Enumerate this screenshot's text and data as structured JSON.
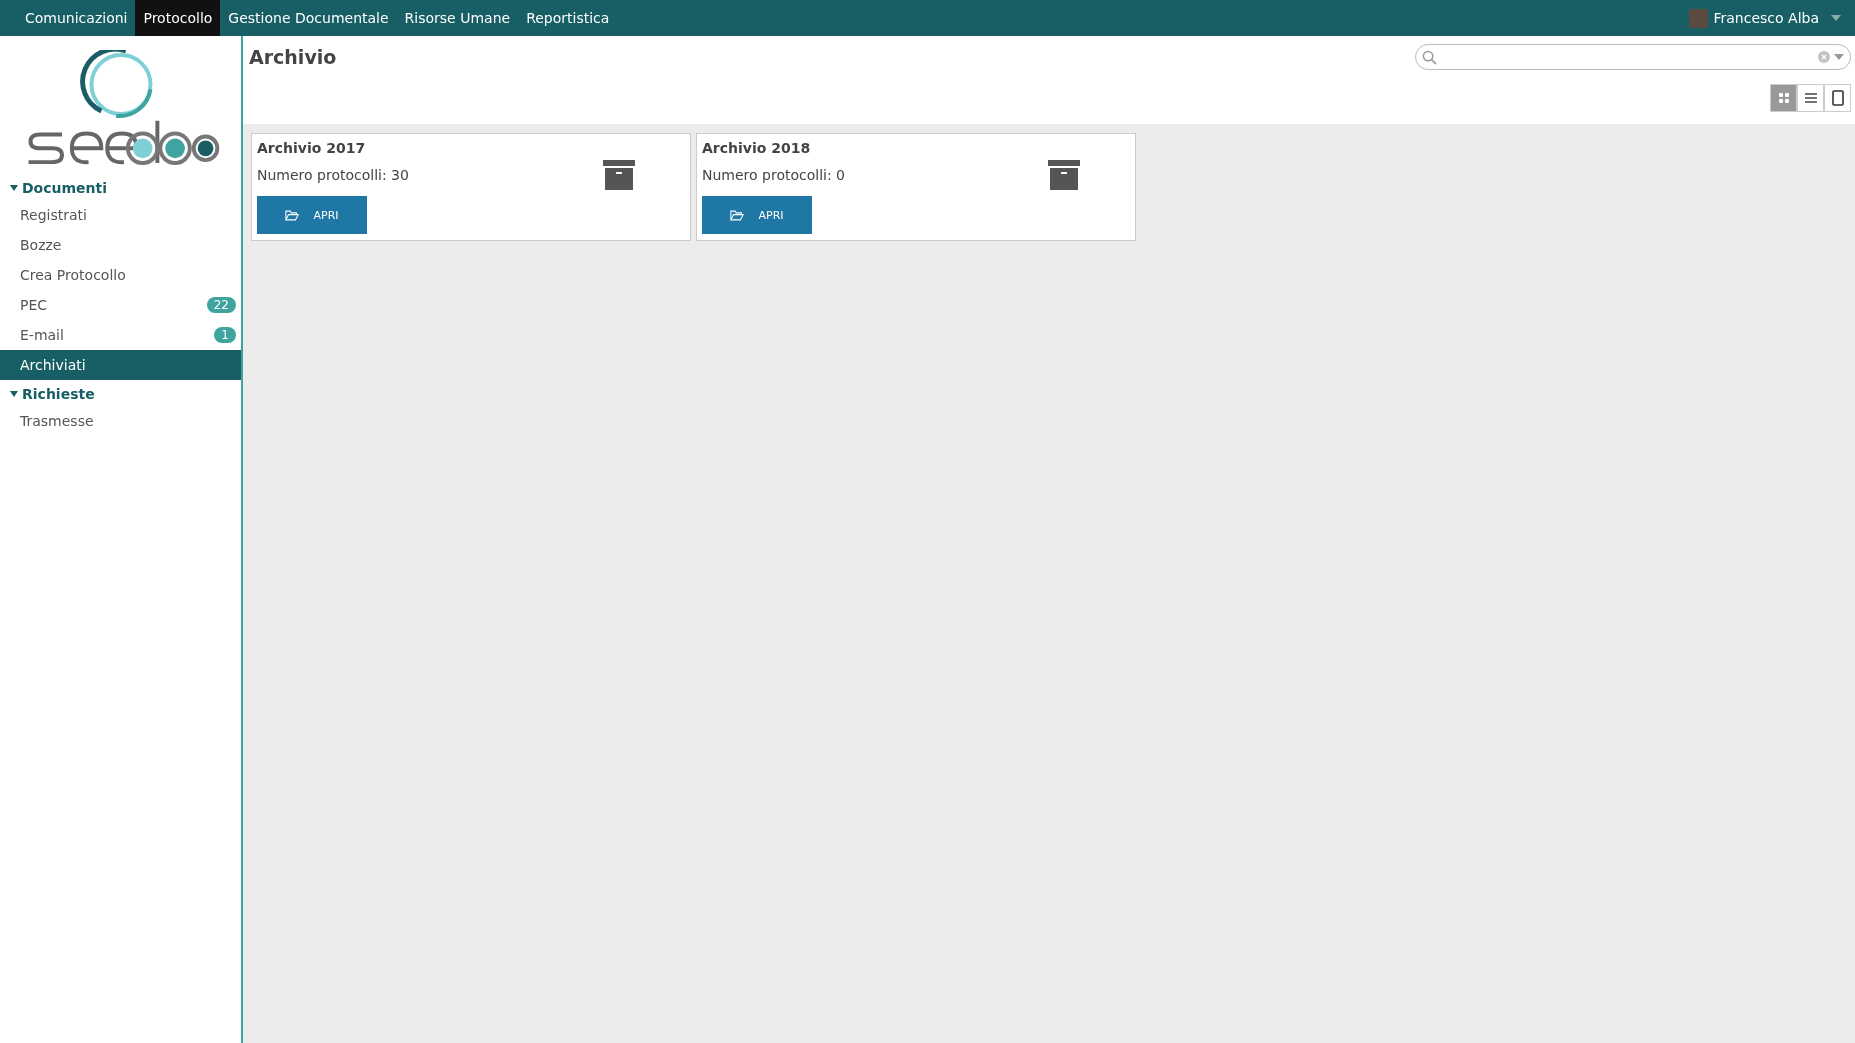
{
  "top_nav": {
    "items": [
      {
        "label": "Comunicazioni",
        "selected": false
      },
      {
        "label": "Protocollo",
        "selected": true
      },
      {
        "label": "Gestione Documentale",
        "selected": false
      },
      {
        "label": "Risorse Umane",
        "selected": false
      },
      {
        "label": "Reportistica",
        "selected": false
      }
    ],
    "user": "Francesco Alba"
  },
  "sidebar": {
    "sections": [
      {
        "title": "Documenti",
        "expanded": true,
        "items": [
          {
            "label": "Registrati",
            "selected": false
          },
          {
            "label": "Bozze",
            "selected": false
          },
          {
            "label": "Crea Protocollo",
            "selected": false
          },
          {
            "label": "PEC",
            "badge": "22",
            "selected": false
          },
          {
            "label": "E-mail",
            "badge": "1",
            "selected": false
          },
          {
            "label": "Archiviati",
            "selected": true
          }
        ]
      },
      {
        "title": "Richieste",
        "expanded": true,
        "items": [
          {
            "label": "Trasmesse",
            "selected": false
          }
        ]
      }
    ]
  },
  "page_title": "Archivio",
  "view_modes": [
    {
      "kind": "grid",
      "selected": true
    },
    {
      "kind": "list",
      "selected": false
    },
    {
      "kind": "form",
      "selected": false
    }
  ],
  "cards": [
    {
      "title": "Archivio 2017",
      "count_text": "Numero protocolli: 30",
      "button": "APRI"
    },
    {
      "title": "Archivio 2018",
      "count_text": "Numero protocolli: 0",
      "button": "APRI"
    }
  ]
}
